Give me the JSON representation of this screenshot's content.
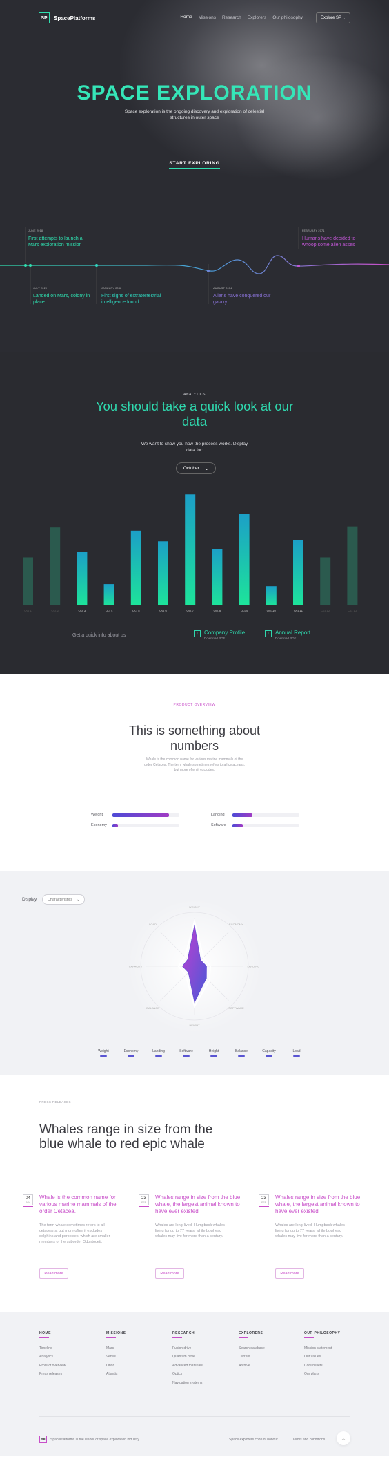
{
  "nav": {
    "logo": "SP",
    "brand": "SpacePlatforms",
    "links": [
      "Home",
      "Missions",
      "Research",
      "Explorers",
      "Our philosophy"
    ],
    "explore": "Explore SP"
  },
  "hero": {
    "title": "SPACE EXPLORATION",
    "subtitle": "Space exploration is the ongoing discovery and exploration of celestial structures in outer space",
    "cta": "START EXPLORING"
  },
  "timeline": [
    {
      "date": "JUNE 2018",
      "text": "First attempts to launch a Mars exploration mission"
    },
    {
      "date": "JULY 2020",
      "text": "Landed on Mars, colony in place"
    },
    {
      "date": "JANUARY 2032",
      "text": "First signs of extraterrestrial intelligence found"
    },
    {
      "date": "AUGUST 2054",
      "text": "Aliens have conquered our galaxy"
    },
    {
      "date": "FEBRUARY 2071",
      "text": "Humans have decided to whoop some alien asses"
    }
  ],
  "analytics": {
    "eyebrow": "ANALYTICS",
    "title": "You should take a quick look at our data",
    "desc": "We want to show you how the process works. Display data for:",
    "month": "October",
    "quick": "Get a quick info about us",
    "downloads": [
      {
        "title": "Company Profile",
        "sub": "Download PDF"
      },
      {
        "title": "Annual Report",
        "sub": "Download PDF"
      }
    ]
  },
  "chart_data": {
    "type": "bar",
    "categories": [
      "Oct 1",
      "Oct 2",
      "Oct 3",
      "Oct 4",
      "Oct 5",
      "Oct 6",
      "Oct 7",
      "Oct 8",
      "Oct 9",
      "Oct 10",
      "Oct 11",
      "Oct 12",
      "Oct 13"
    ],
    "values": [
      45,
      73,
      50,
      20,
      70,
      60,
      104,
      53,
      86,
      18,
      61,
      45,
      74
    ],
    "faded": [
      true,
      true,
      false,
      false,
      false,
      false,
      false,
      false,
      false,
      false,
      false,
      true,
      true
    ],
    "ylim": [
      0,
      110
    ],
    "colors": {
      "bottom": "#1de49a",
      "top": "#1c9fc7",
      "faded": "#2b5a4e"
    }
  },
  "overview": {
    "eyebrow": "PRODUCT OVERVIEW",
    "title": "This is something about numbers",
    "desc": "Whale is the common name for various marine mammals of the order Cetacea. The term whale sometimes refers to all cetaceans, but more often it excludes.",
    "bars": [
      {
        "label": "Weight",
        "value": 0.85
      },
      {
        "label": "Landing",
        "value": 0.3
      },
      {
        "label": "Economy",
        "value": 0.08
      },
      {
        "label": "Software",
        "value": 0.15
      }
    ]
  },
  "radar": {
    "display_label": "Display",
    "select": "Characteristics",
    "axes": [
      "WEIGHT",
      "ECONOMY",
      "LANDING",
      "SOFTWARE",
      "HEIGHT",
      "BALANCE",
      "CAPACITY",
      "LOAD"
    ],
    "values": [
      0.85,
      0.18,
      0.25,
      0.35,
      0.75,
      0.18,
      0.25,
      0.2
    ],
    "legend": [
      "Weight",
      "Economy",
      "Landing",
      "Software",
      "Height",
      "Balance",
      "Capacity",
      "Load"
    ]
  },
  "whales": {
    "eyebrow": "PRESS RELEASES",
    "title": "Whales range in size from the blue whale to red epic whale",
    "cards": [
      {
        "day": "04",
        "month": "JAN",
        "title": "Whale is the common name for various marine mammals of the order Cetacea.",
        "text": "The term whale sometimes refers to all cetaceans, but more often it excludes dolphins and porpoises, which are smaller members of the suborder Odontoceti.",
        "button": "Read more"
      },
      {
        "day": "23",
        "month": "FEB",
        "title": "Whales range in size from the blue whale, the largest animal known to have ever existed",
        "text": "Whales are long-lived. Humpback whales living for up to 77 years, while bowhead whales may live for more than a century.",
        "button": "Read more"
      },
      {
        "day": "23",
        "month": "FEB",
        "title": "Whales range in size from the blue whale, the largest animal known to have ever existed",
        "text": "Whales are long-lived. Humpback whales living for up to 77 years, while bowhead whales may live for more than a century.",
        "button": "Read more"
      }
    ]
  },
  "footer": {
    "columns": [
      {
        "title": "HOME",
        "links": [
          "Timeline",
          "Analytics",
          "Product overview",
          "Press releases"
        ]
      },
      {
        "title": "MISSIONS",
        "links": [
          "Mars",
          "Venus",
          "Orion",
          "Atlantis"
        ]
      },
      {
        "title": "RESEARCH",
        "links": [
          "Fusion drive",
          "Quantum drive",
          "Advanced materials",
          "Optics",
          "Navigation systems"
        ]
      },
      {
        "title": "EXPLORERS",
        "links": [
          "Search database",
          "Current",
          "Archive"
        ]
      },
      {
        "title": "OUR PHILOSOPHY",
        "links": [
          "Mission statement",
          "Our values",
          "Core beliefs",
          "Our plans"
        ]
      }
    ],
    "logo": "SP",
    "tagline": "SpacePlatforms is the leader of space exploration industry",
    "legal": [
      "Space explorers code of honour",
      "Terms and conditions"
    ]
  }
}
